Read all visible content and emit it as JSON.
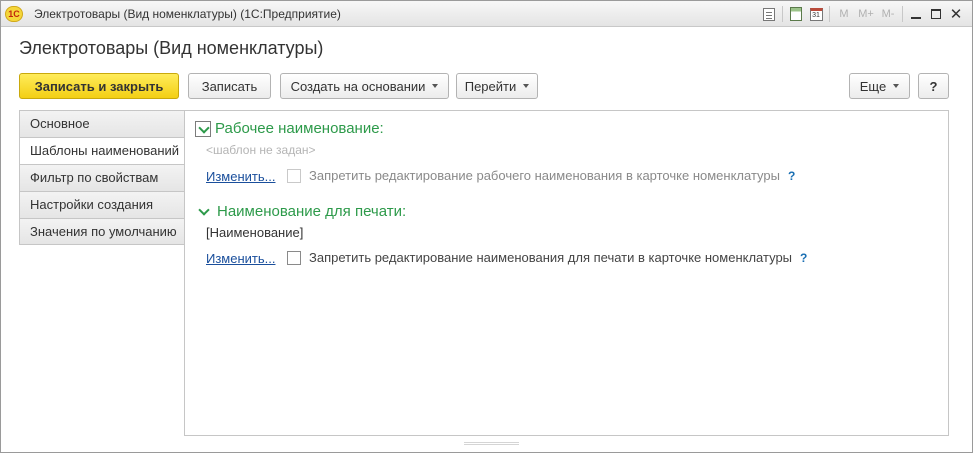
{
  "window": {
    "logo": "1С",
    "title": "Электротовары (Вид номенклатуры)  (1С:Предприятие)",
    "icons": [
      "print-icon",
      "calculator-icon",
      "calendar-icon",
      "memory-icon",
      "memory-add-icon",
      "memory-subtract-icon",
      "minimize-icon",
      "maximize-icon",
      "close-icon"
    ],
    "calendar_day": "31",
    "m_label": "M",
    "m_plus_label": "M+",
    "m_minus_label": "M-",
    "close_glyph": "✕"
  },
  "form": {
    "title": "Электротовары (Вид номенклатуры)"
  },
  "toolbar": {
    "save_close": "Записать и закрыть",
    "save": "Записать",
    "create_based": "Создать на основании",
    "go_to": "Перейти",
    "more": "Еще",
    "help": "?"
  },
  "tabs": [
    {
      "label": "Основное",
      "active": false
    },
    {
      "label": "Шаблоны наименований",
      "active": true
    },
    {
      "label": "Фильтр по свойствам",
      "active": false
    },
    {
      "label": "Настройки создания",
      "active": false
    },
    {
      "label": "Значения по умолчанию",
      "active": false
    }
  ],
  "working_name": {
    "heading": "Рабочее наименование:",
    "template_placeholder": "<шаблон не задан>",
    "change_link": "Изменить...",
    "forbid_label": "Запретить редактирование рабочего наименования в карточке номенклатуры",
    "forbid_checked": false,
    "help": "?"
  },
  "print_name": {
    "heading": "Наименование для печати:",
    "template_value": "[Наименование]",
    "change_link": "Изменить...",
    "forbid_label": "Запретить редактирование наименования для печати в карточке номенклатуры",
    "forbid_checked": false,
    "help": "?"
  },
  "colors": {
    "accent_green": "#2d9a4a",
    "primary_button": "#f3cf15",
    "link_blue": "#1a4f9c"
  }
}
